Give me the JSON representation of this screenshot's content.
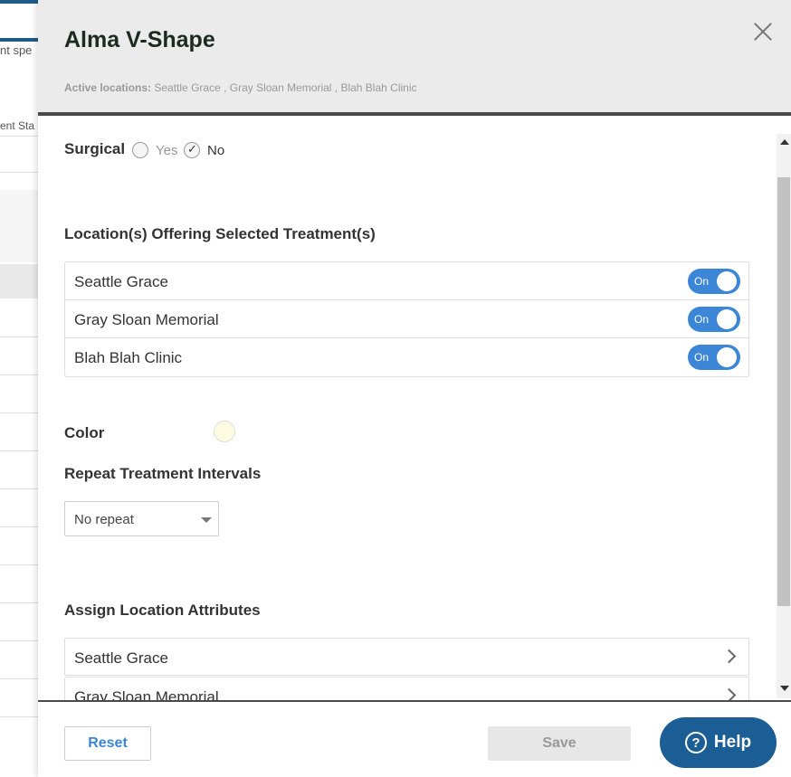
{
  "background": {
    "text_top": "nt spe",
    "text_second": "ent Sta"
  },
  "drawer": {
    "title": "Alma V-Shape",
    "active_locations_label": "Active locations:",
    "active_locations_value": "Seattle Grace , Gray Sloan Memorial , Blah Blah Clinic"
  },
  "surgical": {
    "label": "Surgical",
    "yes_label": "Yes",
    "no_label": "No",
    "selected": "No"
  },
  "locations_section": {
    "title": "Location(s) Offering Selected Treatment(s)",
    "rows": [
      {
        "name": "Seattle Grace",
        "toggle_label": "On"
      },
      {
        "name": "Gray Sloan Memorial",
        "toggle_label": "On"
      },
      {
        "name": "Blah Blah Clinic",
        "toggle_label": "On"
      }
    ]
  },
  "color": {
    "label": "Color",
    "value": "#fdfce3"
  },
  "repeat": {
    "title": "Repeat Treatment Intervals",
    "selected": "No repeat"
  },
  "attributes": {
    "title": "Assign Location Attributes",
    "rows": [
      {
        "name": "Seattle Grace"
      },
      {
        "name": "Gray Sloan Memorial"
      }
    ]
  },
  "footer": {
    "reset_label": "Reset",
    "save_label": "Save",
    "help_label": "Help",
    "help_icon_glyph": "?"
  },
  "colors": {
    "accent": "#3b86d6",
    "help_bg": "#1b5e95",
    "header_bg": "#ebebeb"
  }
}
